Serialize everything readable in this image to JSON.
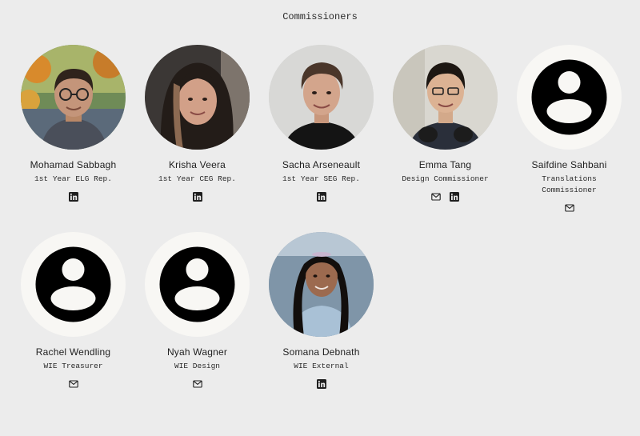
{
  "section": {
    "title": "Commissioners"
  },
  "members": [
    {
      "name": "Mohamad Sabbagh",
      "role": "1st Year ELG Rep.",
      "links": [
        "linkedin"
      ],
      "photo": "photo"
    },
    {
      "name": "Krisha Veera",
      "role": "1st Year CEG Rep.",
      "links": [
        "linkedin"
      ],
      "photo": "photo"
    },
    {
      "name": "Sacha Arseneault",
      "role": "1st Year SEG Rep.",
      "links": [
        "linkedin"
      ],
      "photo": "photo"
    },
    {
      "name": "Emma Tang",
      "role": "Design Commissioner",
      "links": [
        "email",
        "linkedin"
      ],
      "photo": "photo"
    },
    {
      "name": "Saifdine Sahbani",
      "role": "Translations Commissioner",
      "links": [
        "email"
      ],
      "photo": "placeholder"
    },
    {
      "name": "Rachel Wendling",
      "role": "WIE Treasurer",
      "links": [
        "email"
      ],
      "photo": "placeholder"
    },
    {
      "name": "Nyah Wagner",
      "role": "WIE Design",
      "links": [
        "email"
      ],
      "photo": "placeholder"
    },
    {
      "name": "Somana Debnath",
      "role": "WIE External",
      "links": [
        "linkedin"
      ],
      "photo": "photo"
    }
  ],
  "colors": {
    "background": "#ececec",
    "placeholder_bg": "#f8f7f4",
    "icon": "#1f1f1f"
  }
}
